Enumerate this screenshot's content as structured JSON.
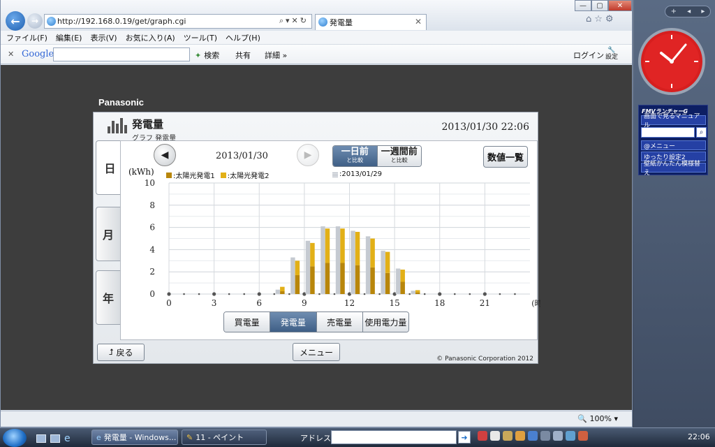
{
  "browser": {
    "url": "http://192.168.0.19/get/graph.cgi",
    "tab_title": "発電量",
    "menu": [
      "ファイル(F)",
      "編集(E)",
      "表示(V)",
      "お気に入り(A)",
      "ツール(T)",
      "ヘルプ(H)"
    ],
    "google_bar": {
      "logo": "Google",
      "search": "検索",
      "share": "共有",
      "detail": "詳細 »",
      "login": "ログイン",
      "settings": "設定"
    },
    "zoom": "100%"
  },
  "app": {
    "brand": "Panasonic",
    "title": "発電量",
    "subtitle": "グラフ  発電量",
    "datetime": "2013/01/30  22:06",
    "side_tabs": [
      "日",
      "月",
      "年"
    ],
    "current_date": "2013/01/30",
    "compare": {
      "day_big": "一日前",
      "day_small": "と比較",
      "week_big": "一週間前",
      "week_small": "と比較"
    },
    "list_button": "数値一覧",
    "unit": "(kWh)",
    "legend": [
      {
        "label": ":太陽光発電1",
        "color": "#b8860b"
      },
      {
        "label": ":太陽光発電2",
        "color": "#e2b017"
      }
    ],
    "legend_compare": {
      "label": ":2013/01/29",
      "color": "#b9bec6"
    },
    "segments": [
      "買電量",
      "発電量",
      "売電量",
      "使用電力量"
    ],
    "active_segment": "発電量",
    "back_button": "戻る",
    "menu_button": "メニュー",
    "copyright": "© Panasonic Corporation 2012"
  },
  "chart_data": {
    "type": "bar",
    "x_unit_label": "(時)",
    "ylabel": "(kWh)",
    "ylim": [
      0,
      10
    ],
    "y_ticks": [
      0,
      2,
      4,
      6,
      8,
      10
    ],
    "x_ticks": [
      0,
      3,
      6,
      9,
      12,
      15,
      18,
      21
    ],
    "hours": [
      0,
      1,
      2,
      3,
      4,
      5,
      6,
      7,
      8,
      9,
      10,
      11,
      12,
      13,
      14,
      15,
      16,
      17,
      18,
      19,
      20,
      21,
      22,
      23
    ],
    "series": [
      {
        "name": "太陽光発電1",
        "color": "#b8860b",
        "values": [
          0,
          0,
          0,
          0,
          0,
          0,
          0,
          0.25,
          1.7,
          2.5,
          2.8,
          2.8,
          2.6,
          2.4,
          1.9,
          1.1,
          0.15,
          0,
          0,
          0,
          0,
          0,
          0,
          0
        ]
      },
      {
        "name": "太陽光発電2",
        "color": "#e2b017",
        "values": [
          0,
          0,
          0,
          0,
          0,
          0,
          0,
          0.4,
          1.3,
          2.1,
          3.1,
          3.1,
          3.0,
          2.6,
          1.9,
          1.1,
          0.2,
          0,
          0,
          0,
          0,
          0,
          0,
          0
        ]
      },
      {
        "name": "2013/01/29",
        "color": "#b9bec6",
        "values": [
          0,
          0,
          0,
          0,
          0,
          0,
          0,
          0.4,
          3.3,
          4.8,
          6.1,
          6.1,
          5.7,
          5.2,
          3.9,
          2.3,
          0.3,
          0,
          0,
          0,
          0,
          0,
          0,
          0
        ]
      }
    ]
  },
  "gadgets": {
    "fmv_title": "FMVランチャーG",
    "fmv_items": [
      "画面で見るマニュアル",
      "@メニュー",
      "ゆったり設定2",
      "壁紙かんたん模様替え"
    ]
  },
  "taskbar": {
    "task1": "発電量 - Windows...",
    "task2": "11 - ペイント",
    "address_label": "アドレス",
    "time": "22:06"
  }
}
